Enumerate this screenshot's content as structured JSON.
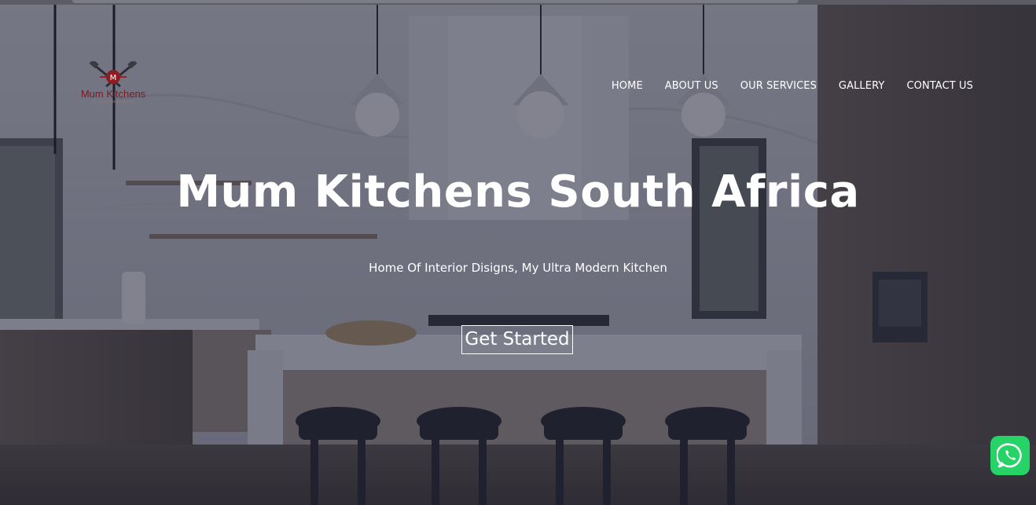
{
  "brand": {
    "name": "Mum Kitchens",
    "tagline": "My Ultra Modern Kitchen",
    "logo_icon": "crossed-utensils-m-badge-icon",
    "color": "#7a1c22"
  },
  "nav": {
    "items": [
      {
        "label": "HOME"
      },
      {
        "label": "ABOUT US"
      },
      {
        "label": "OUR SERVICES"
      },
      {
        "label": "GALLERY"
      },
      {
        "label": "CONTACT US"
      }
    ]
  },
  "hero": {
    "title": "Mum Kitchens South Africa",
    "subtitle": "Home Of Interior Disigns, My Ultra Modern Kitchen",
    "cta_label": "Get Started",
    "background_icon": "modern-kitchen-photo"
  },
  "floating": {
    "whatsapp_icon": "whatsapp-icon",
    "whatsapp_color": "#25d366"
  }
}
